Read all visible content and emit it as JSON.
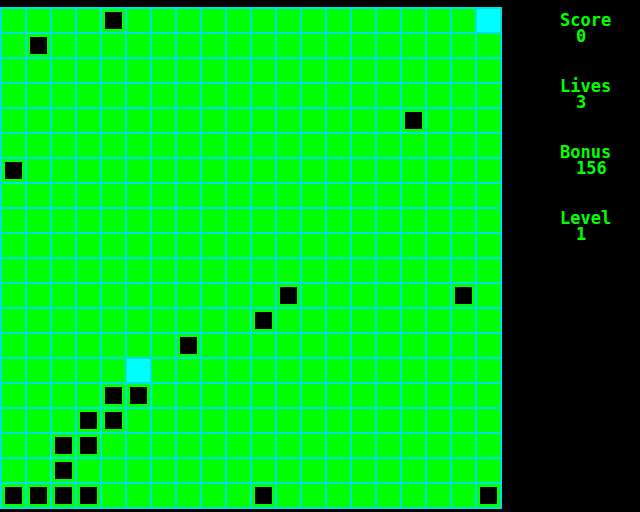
{
  "board": {
    "cols": 20,
    "rows": 20,
    "objects": [
      {
        "kind": "block",
        "col": 4,
        "row": 0
      },
      {
        "kind": "marker",
        "col": 19,
        "row": 0
      },
      {
        "kind": "block",
        "col": 1,
        "row": 1
      },
      {
        "kind": "block",
        "col": 16,
        "row": 4
      },
      {
        "kind": "block",
        "col": 0,
        "row": 6
      },
      {
        "kind": "block",
        "col": 11,
        "row": 11
      },
      {
        "kind": "block",
        "col": 18,
        "row": 11
      },
      {
        "kind": "block",
        "col": 10,
        "row": 12
      },
      {
        "kind": "block",
        "col": 7,
        "row": 13
      },
      {
        "kind": "marker",
        "col": 5,
        "row": 14
      },
      {
        "kind": "block",
        "col": 4,
        "row": 15
      },
      {
        "kind": "block",
        "col": 5,
        "row": 15
      },
      {
        "kind": "block",
        "col": 3,
        "row": 16
      },
      {
        "kind": "block",
        "col": 4,
        "row": 16
      },
      {
        "kind": "block",
        "col": 2,
        "row": 17
      },
      {
        "kind": "block",
        "col": 3,
        "row": 17
      },
      {
        "kind": "block",
        "col": 2,
        "row": 18
      },
      {
        "kind": "block",
        "col": 0,
        "row": 19
      },
      {
        "kind": "block",
        "col": 1,
        "row": 19
      },
      {
        "kind": "block",
        "col": 2,
        "row": 19
      },
      {
        "kind": "block",
        "col": 3,
        "row": 19
      },
      {
        "kind": "block",
        "col": 10,
        "row": 19
      },
      {
        "kind": "block",
        "col": 19,
        "row": 19
      }
    ]
  },
  "stats": [
    {
      "label": "Score",
      "value": "0"
    },
    {
      "label": "Lives",
      "value": "3"
    },
    {
      "label": "Bonus",
      "value": "156"
    },
    {
      "label": "Level",
      "value": "1"
    }
  ]
}
